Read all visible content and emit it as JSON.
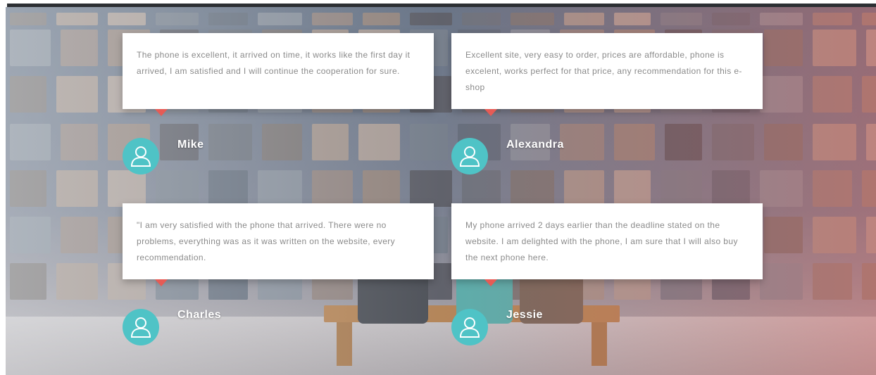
{
  "testimonials": [
    {
      "name": "Mike",
      "text": "The phone is excellent, it arrived on time, it works like the first day it arrived, I am satisfied and I will continue the cooperation for sure.",
      "avatar_icon": "user-icon"
    },
    {
      "name": "Alexandra",
      "text": "Excellent site, very easy to order, prices are affordable, phone is excelent, works perfect for that price, any recommendation for this e-shop",
      "avatar_icon": "user-icon"
    },
    {
      "name": "Charles",
      "text": "\"I am very satisfied with the phone that arrived. There were no problems, everything was as it was written on the website, every recommendation.",
      "avatar_icon": "user-icon"
    },
    {
      "name": "Jessie",
      "text": "My phone arrived 2 days earlier than the deadline stated on the website. I am delighted with the phone, I am sure that I will also buy the next phone here.",
      "avatar_icon": "user-icon"
    }
  ],
  "colors": {
    "accent_teal": "#4fc3c6",
    "pointer_red": "#e65b55",
    "card_text": "#8a8a8a"
  }
}
